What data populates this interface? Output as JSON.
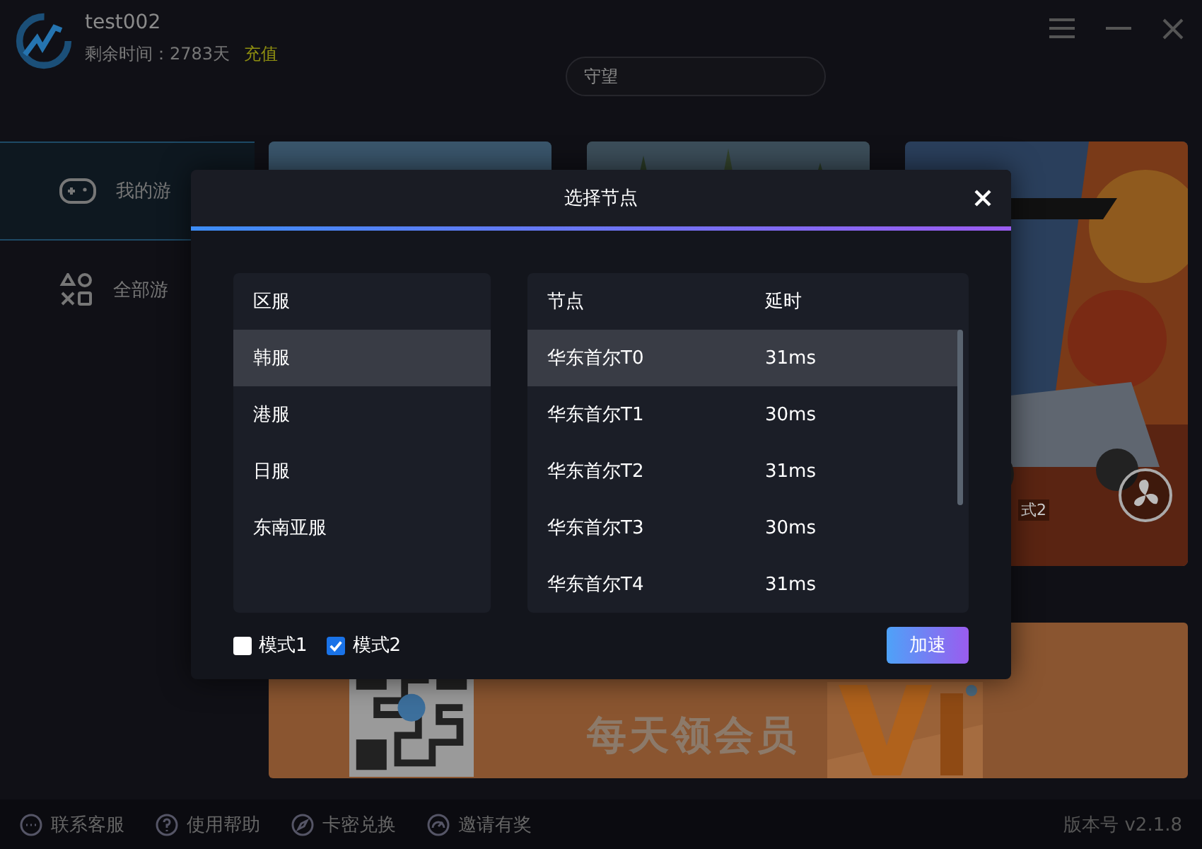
{
  "account": {
    "username": "test002",
    "remaining": "剩余时间：2783天",
    "recharge": "充值"
  },
  "search": {
    "value": "守望"
  },
  "sidebar": {
    "items": [
      {
        "label": "我的游",
        "selected": true
      },
      {
        "label": "全部游",
        "selected": false
      }
    ]
  },
  "game_card": {
    "caption": "式2"
  },
  "banner": {
    "text": "每天领会员"
  },
  "footer": {
    "links": [
      "联系客服",
      "使用帮助",
      "卡密兑换",
      "邀请有奖"
    ],
    "version": "版本号 v2.1.8"
  },
  "dialog": {
    "title": "选择节点",
    "regions": {
      "heading": "区服",
      "items": [
        {
          "name": "韩服",
          "selected": true
        },
        {
          "name": "港服",
          "selected": false
        },
        {
          "name": "日服",
          "selected": false
        },
        {
          "name": "东南亚服",
          "selected": false
        }
      ]
    },
    "nodes": {
      "columns": [
        "节点",
        "延时"
      ],
      "rows": [
        {
          "name": "华东首尔T0",
          "latency": "31ms",
          "selected": true
        },
        {
          "name": "华东首尔T1",
          "latency": "30ms",
          "selected": false
        },
        {
          "name": "华东首尔T2",
          "latency": "31ms",
          "selected": false
        },
        {
          "name": "华东首尔T3",
          "latency": "30ms",
          "selected": false
        },
        {
          "name": "华东首尔T4",
          "latency": "31ms",
          "selected": false
        }
      ]
    },
    "modes": [
      {
        "label": "模式1",
        "checked": false
      },
      {
        "label": "模式2",
        "checked": true
      }
    ],
    "button": "加速"
  }
}
